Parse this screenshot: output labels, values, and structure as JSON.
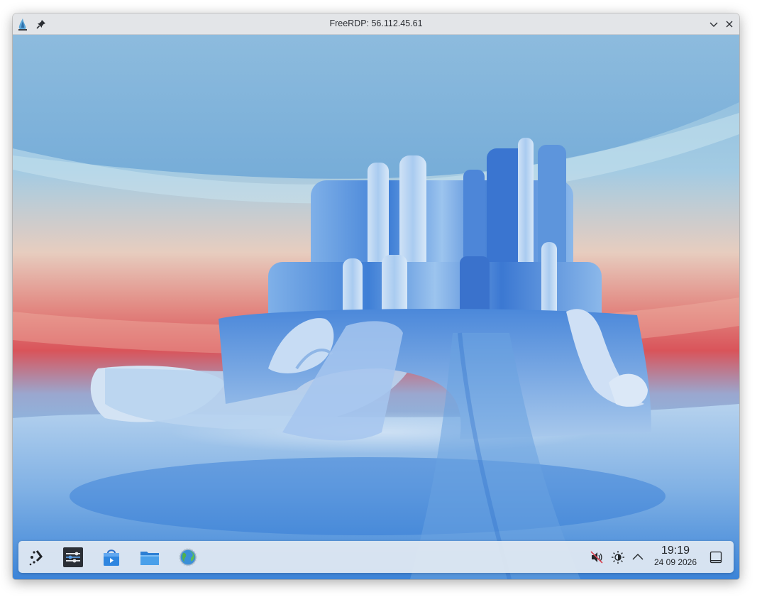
{
  "window": {
    "title": "FreeRDP: 56.112.45.61",
    "buttons": {
      "pin": "pin-icon",
      "minimize": "chevron-down-icon",
      "close": "close-icon"
    }
  },
  "taskbar": {
    "apps": [
      {
        "name": "launcher",
        "icon": "app-launcher-icon"
      },
      {
        "name": "system-settings",
        "icon": "settings-sliders-icon"
      },
      {
        "name": "discover",
        "icon": "store-bag-icon"
      },
      {
        "name": "dolphin",
        "icon": "folder-icon"
      },
      {
        "name": "browser",
        "icon": "globe-icon"
      }
    ],
    "tray": {
      "icons": [
        "speaker-muted-icon",
        "brightness-icon",
        "chevron-up-icon"
      ]
    },
    "clock": {
      "time": "19:19",
      "date": "24 09 2026"
    },
    "show_desktop_icon": "show-desktop-icon"
  },
  "colors": {
    "titlebar": "#e3e5e8",
    "panel": "#e2e9f2",
    "wallpaper_blue": "#3f82d6",
    "wallpaper_red": "#d9545a"
  }
}
